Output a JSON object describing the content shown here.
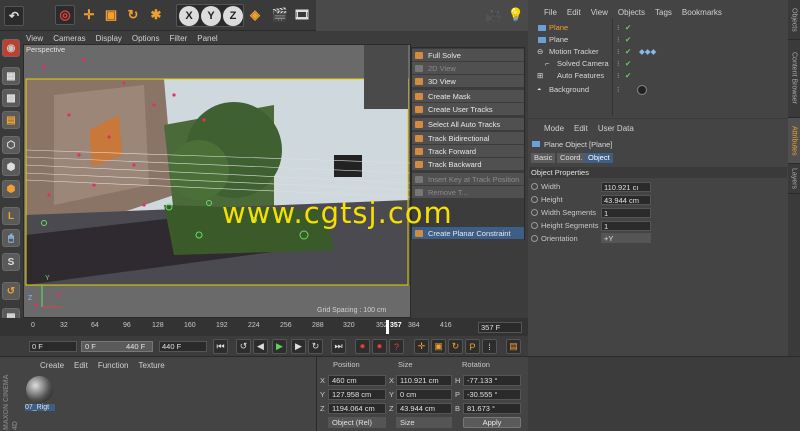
{
  "toolbar": {
    "undo_icon": "undo-icon"
  },
  "viewport_menu": [
    "View",
    "Cameras",
    "Display",
    "Options",
    "Filter",
    "Panel"
  ],
  "viewport": {
    "name": "Perspective",
    "grid_spacing": "Grid Spacing : 100 cm",
    "axis_y": "Y",
    "axis_z": "Z"
  },
  "xyz": [
    "X",
    "Y",
    "Z"
  ],
  "context_menu": {
    "items": [
      {
        "label": "Full Solve",
        "disabled": false
      },
      {
        "label": "2D View",
        "disabled": true
      },
      {
        "label": "3D View",
        "disabled": false
      },
      {
        "label": "Create Mask",
        "disabled": false
      },
      {
        "label": "Create User Tracks",
        "disabled": false
      },
      {
        "label": "Select All Auto Tracks",
        "disabled": false
      },
      {
        "label": "Track Bidirectional",
        "disabled": false
      },
      {
        "label": "Track Forward",
        "disabled": false
      },
      {
        "label": "Track Backward",
        "disabled": false
      },
      {
        "label": "Insert Key at Track Position",
        "disabled": true
      },
      {
        "label": "Remove T...",
        "disabled": true
      },
      {
        "label": "Create Planar Constraint",
        "disabled": false
      }
    ]
  },
  "watermark": "www.cgtsj.com",
  "object_manager": {
    "menu": [
      "File",
      "Edit",
      "View",
      "Objects",
      "Tags",
      "Bookmarks"
    ],
    "rows": [
      {
        "name": "Plane",
        "indent": 0,
        "selected": true
      },
      {
        "name": "Plane",
        "indent": 0,
        "selected": false
      },
      {
        "name": "Motion Tracker",
        "indent": 0,
        "selected": false
      },
      {
        "name": "Solved Camera",
        "indent": 1,
        "selected": false
      },
      {
        "name": "Auto Features",
        "indent": 1,
        "selected": false
      },
      {
        "name": "Background",
        "indent": 0,
        "selected": false
      }
    ]
  },
  "right_tabs": [
    "Objects",
    "Content Browser",
    "Attributes",
    "Layers"
  ],
  "attributes": {
    "menu": [
      "Mode",
      "Edit",
      "User Data"
    ],
    "object_title": "Plane Object [Plane]",
    "tabs": [
      "Basic",
      "Coord.",
      "Object"
    ],
    "active_tab": "Object",
    "section": "Object Properties",
    "width_label": "Width",
    "width_value": "110.921 cı",
    "height_label": "Height",
    "height_value": "43.944 cm",
    "wseg_label": "Width Segments",
    "wseg_value": "1",
    "hseg_label": "Height Segments",
    "hseg_value": "1",
    "orientation_label": "Orientation",
    "orientation_value": "+Y"
  },
  "timeline": {
    "ticks": [
      "0",
      "32",
      "64",
      "96",
      "128",
      "160",
      "192",
      "224",
      "256",
      "288",
      "320",
      "352",
      "357",
      "384",
      "416"
    ],
    "current_frame": "357 F",
    "start": "0 F",
    "min": "0 F",
    "max": "440 F",
    "end": "440 F"
  },
  "material_manager": {
    "menu": [
      "Create",
      "Edit",
      "Function",
      "Texture"
    ],
    "material_name": "07_Rigt",
    "logo_line1": "MAXON",
    "logo_line2": "CINEMA 4D"
  },
  "coordinates": {
    "headers": [
      "Position",
      "Size",
      "Rotation"
    ],
    "rows": [
      {
        "axis": "X",
        "pos": "460 cm",
        "size_axis": "X",
        "size": "110.921 cm",
        "rot_axis": "H",
        "rot": "-77.133 °"
      },
      {
        "axis": "Y",
        "pos": "127.958 cm",
        "size_axis": "Y",
        "size": "0 cm",
        "rot_axis": "P",
        "rot": "-30.555 °"
      },
      {
        "axis": "Z",
        "pos": "1194.064 cm",
        "size_axis": "Z",
        "size": "43.944 cm",
        "rot_axis": "B",
        "rot": "81.673 °"
      }
    ],
    "mode": "Object (Rel)",
    "size_mode": "Size",
    "apply": "Apply"
  }
}
